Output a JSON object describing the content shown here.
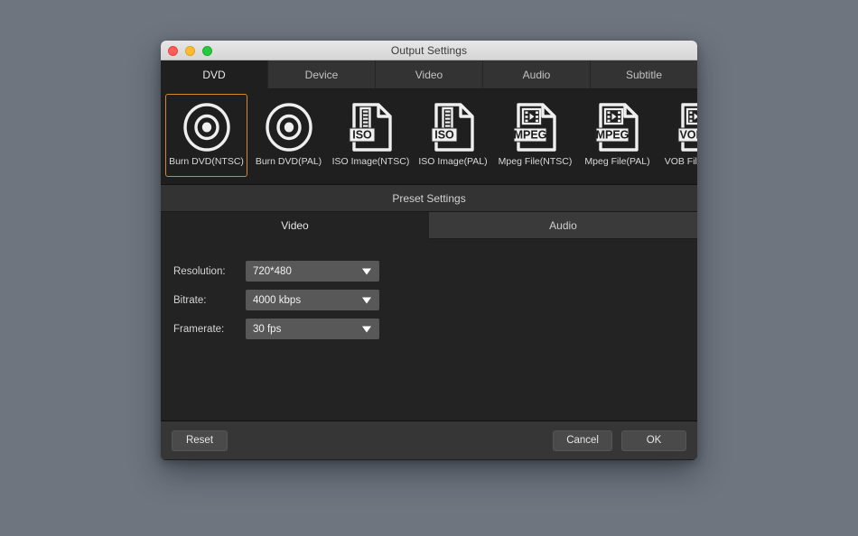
{
  "window": {
    "title": "Output Settings",
    "traffic_lights": [
      "close",
      "minimize",
      "zoom"
    ]
  },
  "tabs": [
    {
      "label": "DVD",
      "active": true
    },
    {
      "label": "Device",
      "active": false
    },
    {
      "label": "Video",
      "active": false
    },
    {
      "label": "Audio",
      "active": false
    },
    {
      "label": "Subtitle",
      "active": false
    }
  ],
  "formats": [
    {
      "label": "Burn DVD(NTSC)",
      "icon": "disc-icon",
      "selected": true
    },
    {
      "label": "Burn DVD(PAL)",
      "icon": "disc-icon",
      "selected": false
    },
    {
      "label": "ISO Image(NTSC)",
      "icon": "iso-file-icon",
      "badge": "ISO",
      "selected": false
    },
    {
      "label": "ISO Image(PAL)",
      "icon": "iso-file-icon",
      "badge": "ISO",
      "selected": false
    },
    {
      "label": "Mpeg File(NTSC)",
      "icon": "mpeg-file-icon",
      "badge": "MPEG",
      "selected": false
    },
    {
      "label": "Mpeg File(PAL)",
      "icon": "mpeg-file-icon",
      "badge": "MPEG",
      "selected": false
    },
    {
      "label": "VOB File(NTSC)",
      "icon": "vob-file-icon",
      "badge": "VOB",
      "selected": false
    }
  ],
  "preset": {
    "header": "Preset Settings",
    "subtabs": [
      {
        "label": "Video",
        "active": true
      },
      {
        "label": "Audio",
        "active": false
      }
    ],
    "fields": [
      {
        "label": "Resolution:",
        "value": "720*480"
      },
      {
        "label": "Bitrate:",
        "value": "4000 kbps"
      },
      {
        "label": "Framerate:",
        "value": "30 fps"
      }
    ]
  },
  "footer": {
    "reset": "Reset",
    "cancel": "Cancel",
    "ok": "OK"
  },
  "colors": {
    "desktop": "#6e757f",
    "accent_selected": "#d08a28",
    "panel": "#232323",
    "tabbar": "#333333"
  }
}
